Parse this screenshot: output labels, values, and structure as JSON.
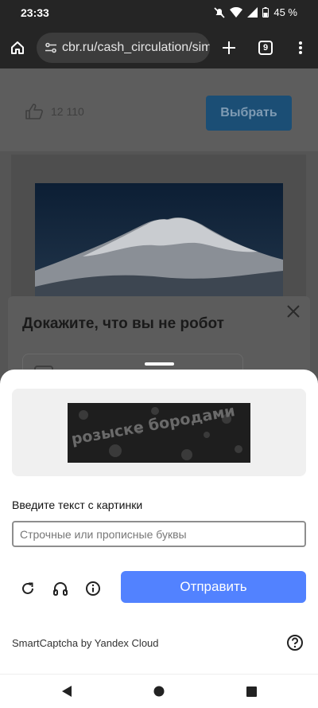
{
  "status_bar": {
    "time": "23:33",
    "battery": "45 %"
  },
  "browser": {
    "url": "cbr.ru/cash_circulation/simv",
    "tab_count": "9"
  },
  "page": {
    "like_count": "12 110",
    "choose_button": "Выбрать"
  },
  "robot_dialog": {
    "title": "Докажите, что вы не робот"
  },
  "captcha": {
    "image_text": "розыске бородами",
    "input_label": "Введите текст с картинки",
    "input_placeholder": "Строчные или прописные буквы",
    "submit_label": "Отправить",
    "brand": "SmartCaptcha by Yandex Cloud",
    "icons": [
      "refresh-icon",
      "headphones-icon",
      "info-icon",
      "help-icon"
    ]
  },
  "colors": {
    "accent": "#5282ff",
    "dim_button": "#1b4e75"
  }
}
